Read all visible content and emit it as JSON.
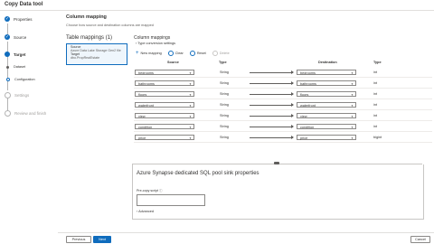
{
  "app": {
    "title": "Copy Data tool"
  },
  "steps": [
    {
      "label": "Properties",
      "state": "done"
    },
    {
      "label": "Source",
      "state": "done"
    },
    {
      "label": "Target",
      "state": "current"
    },
    {
      "label": "Settings",
      "state": "pending"
    },
    {
      "label": "Review and finish",
      "state": "pending"
    }
  ],
  "substeps": [
    {
      "label": "Dataset",
      "state": "done"
    },
    {
      "label": "Configuration",
      "state": "current"
    }
  ],
  "main": {
    "title": "Column mapping",
    "description": "Choose how source and destination columns are mapped",
    "table_mappings_title": "Table mappings (1)",
    "source_card": {
      "label": "Source",
      "source_desc": "Azure Data Lake Storage Gen2 file",
      "target_label": "Target",
      "target_desc": "dbo.PropRealEstate"
    },
    "column_mappings_title": "Column mappings",
    "type_conversion": "Type conversion settings",
    "toolbar": {
      "new_mapping": "New mapping",
      "clear": "Clear",
      "reset": "Reset",
      "delete": "Delete"
    },
    "columns": {
      "source": "Source",
      "type": "Type",
      "destination": "Destination",
      "dest_type": "Type"
    },
    "rows": [
      {
        "source": "bedrooms",
        "type": "String",
        "destination": "bedrooms",
        "dest_type": "int"
      },
      {
        "source": "bathrooms",
        "type": "String",
        "destination": "bathrooms",
        "dest_type": "int"
      },
      {
        "source": "floors",
        "type": "String",
        "destination": "floors",
        "dest_type": "int"
      },
      {
        "source": "waterfront",
        "type": "String",
        "destination": "waterfront",
        "dest_type": "int"
      },
      {
        "source": "view",
        "type": "String",
        "destination": "view",
        "dest_type": "int"
      },
      {
        "source": "condition",
        "type": "String",
        "destination": "condition",
        "dest_type": "int"
      },
      {
        "source": "price",
        "type": "String",
        "destination": "price",
        "dest_type": "bigint"
      }
    ],
    "sink": {
      "title": "Azure Synapse dedicated SQL pool sink properties",
      "pre_copy_label": "Pre-copy script",
      "pre_copy_value": "",
      "advanced": "Advanced"
    }
  },
  "footer": {
    "previous": "Previous",
    "next": "Next",
    "cancel": "Cancel"
  },
  "colors": {
    "accent": "#0f6cbd"
  }
}
